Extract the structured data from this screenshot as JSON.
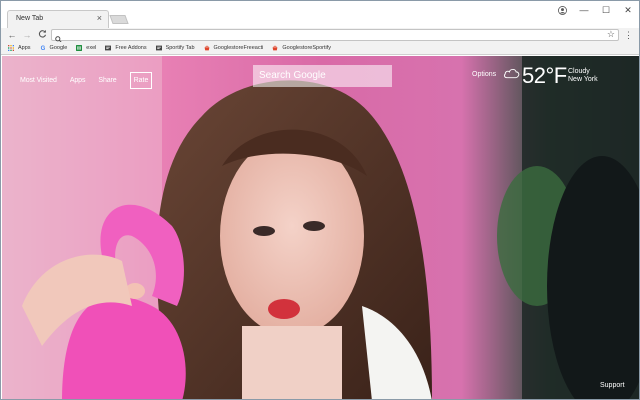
{
  "browser": {
    "tab_title": "New Tab",
    "tab_close": "×",
    "window_controls": {
      "minimize": "—",
      "maximize": "☐",
      "close": "✕"
    },
    "nav": {
      "back": "←",
      "forward": "→",
      "reload": "C"
    },
    "omnibox_value": "",
    "bookmarks": [
      {
        "label": "Apps",
        "icon": "apps-grid-icon",
        "color": "#d04a3a"
      },
      {
        "label": "Google",
        "icon": "google-icon",
        "color": "#4285f4"
      },
      {
        "label": "exel",
        "icon": "sheets-icon",
        "color": "#1e8e3e"
      },
      {
        "label": "Free Addons",
        "icon": "addon-icon",
        "color": "#444444"
      },
      {
        "label": "Sportify Tab",
        "icon": "sportify-icon",
        "color": "#444444"
      },
      {
        "label": "GooglestoreFreeacti",
        "icon": "store-icon",
        "color": "#e0442b"
      },
      {
        "label": "GooglestoreSportify",
        "icon": "store-icon",
        "color": "#e0442b"
      }
    ]
  },
  "page": {
    "nav_links": [
      "Most Visited",
      "Apps",
      "Share"
    ],
    "rate_label": "Rate",
    "search_placeholder": "Search Google",
    "options_label": "Options",
    "weather": {
      "icon": "cloud-icon",
      "temperature": "52°F",
      "condition": "Cloudy",
      "location": "New York"
    },
    "support_label": "Support"
  }
}
